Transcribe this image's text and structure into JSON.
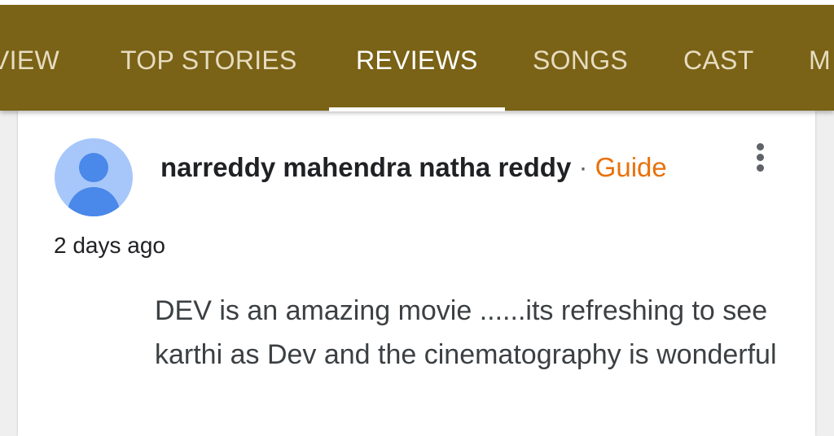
{
  "tabs": [
    {
      "label": "VIEW"
    },
    {
      "label": "TOP STORIES"
    },
    {
      "label": "REVIEWS"
    },
    {
      "label": "SONGS"
    },
    {
      "label": "CAST"
    },
    {
      "label": "M"
    }
  ],
  "active_tab": "REVIEWS",
  "review": {
    "author_name": "narreddy mahendra natha reddy",
    "separator": "·",
    "badge": "Guide",
    "time": "2 days ago",
    "text": "DEV is an amazing movie ......its refreshing to see karthi as Dev and the cinematography is wonderful"
  },
  "icons": {
    "avatar": "user-avatar-icon",
    "menu": "more-vert-icon"
  },
  "colors": {
    "tab_bar": "#7a6216",
    "badge": "#e8710a",
    "avatar_bg": "#a7c7fa",
    "avatar_fg": "#4a88ea"
  }
}
